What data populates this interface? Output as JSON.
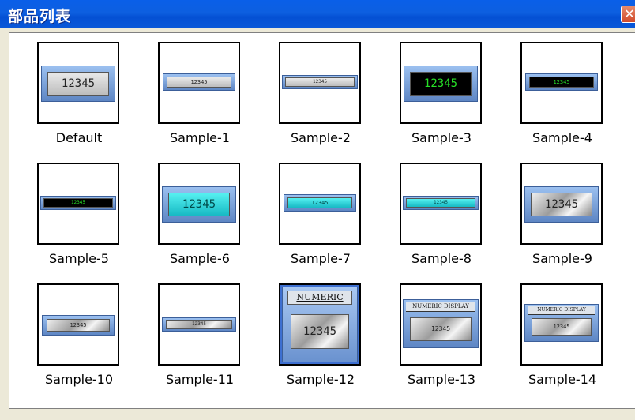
{
  "window": {
    "title": "部品列表",
    "close_glyph": "✕"
  },
  "items": [
    {
      "caption": "Default",
      "value": "12345"
    },
    {
      "caption": "Sample-1",
      "value": "12345"
    },
    {
      "caption": "Sample-2",
      "value": "12345"
    },
    {
      "caption": "Sample-3",
      "value": "12345"
    },
    {
      "caption": "Sample-4",
      "value": "12345"
    },
    {
      "caption": "Sample-5",
      "value": "12345"
    },
    {
      "caption": "Sample-6",
      "value": "12345"
    },
    {
      "caption": "Sample-7",
      "value": "12345"
    },
    {
      "caption": "Sample-8",
      "value": "12345"
    },
    {
      "caption": "Sample-9",
      "value": "12345"
    },
    {
      "caption": "Sample-10",
      "value": "12345"
    },
    {
      "caption": "Sample-11",
      "value": "12345"
    },
    {
      "caption": "Sample-12",
      "value": "12345",
      "header": "NUMERIC"
    },
    {
      "caption": "Sample-13",
      "value": "12345",
      "header": "NUMERIC DISPLAY"
    },
    {
      "caption": "Sample-14",
      "value": "12345",
      "header": "NUMERIC DISPLAY"
    }
  ],
  "selected_caption": "Sample-12"
}
